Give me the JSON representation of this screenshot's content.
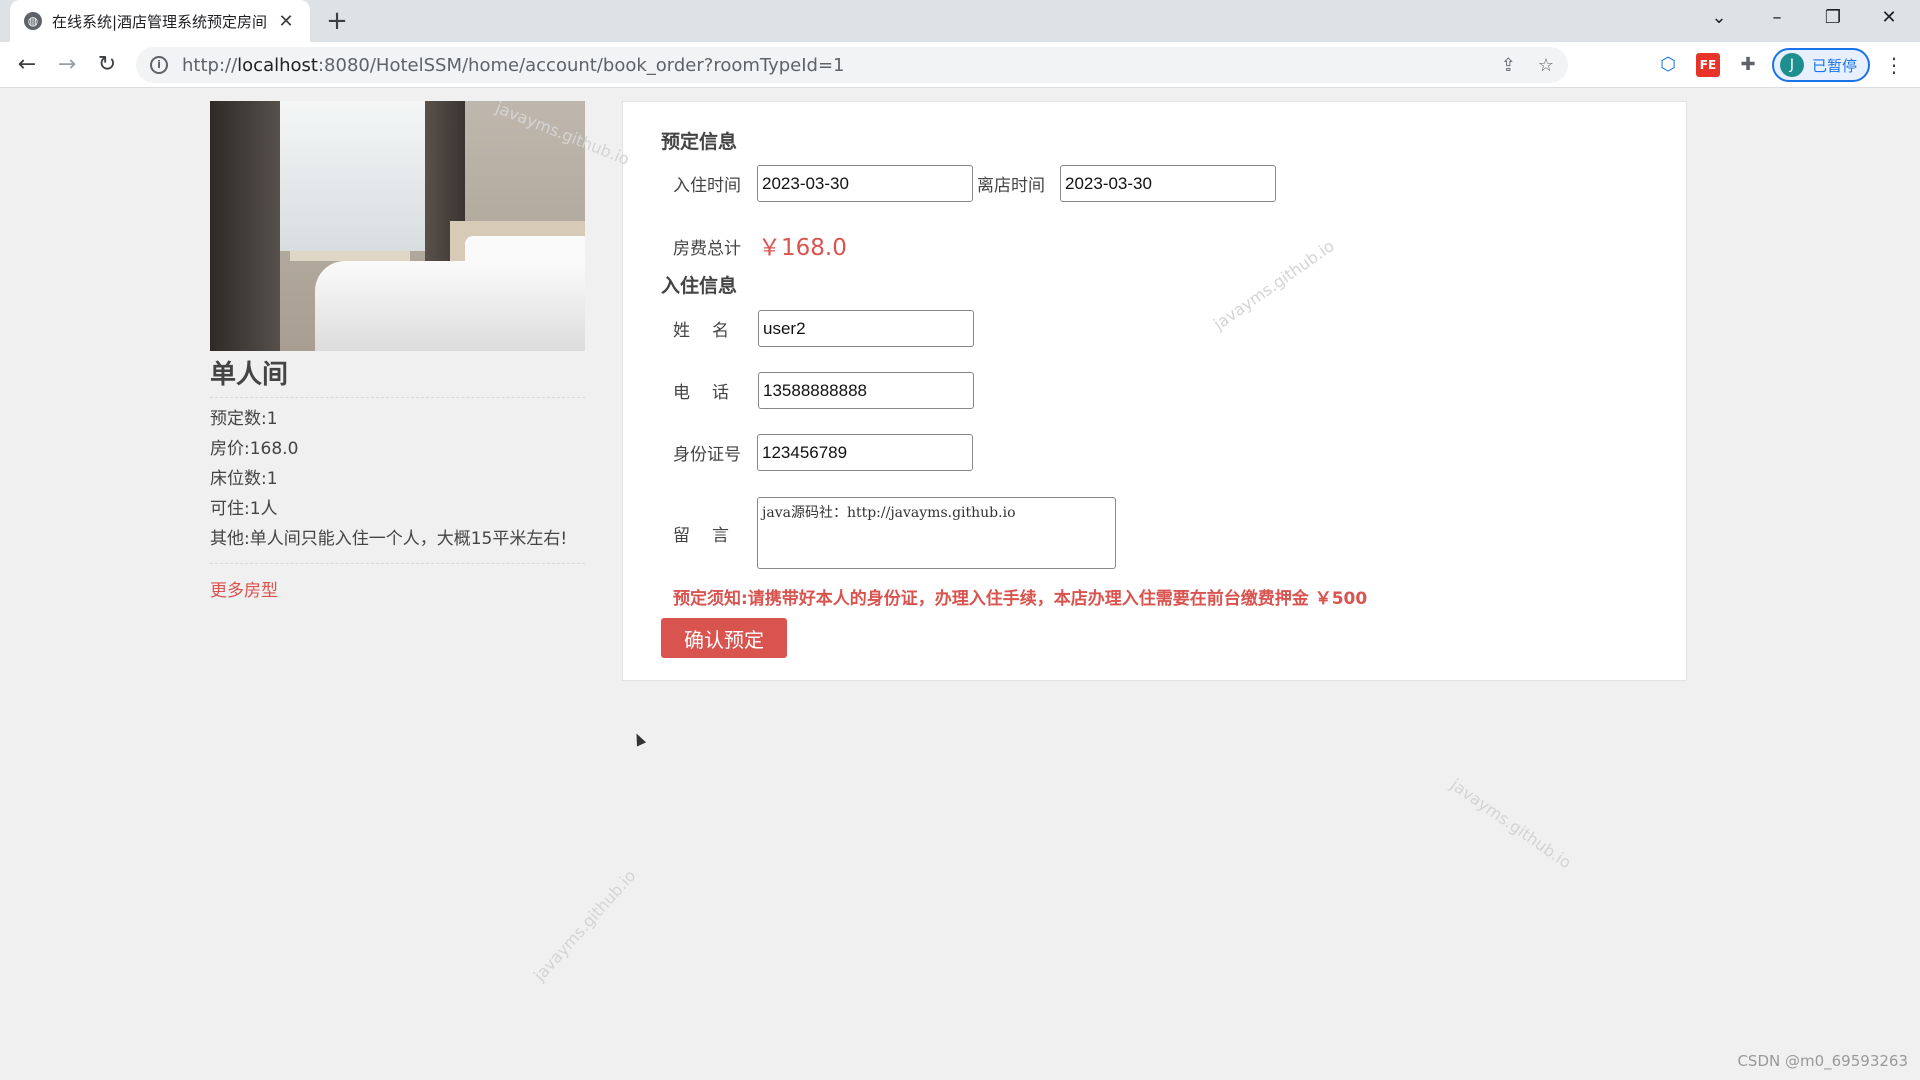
{
  "browser": {
    "tab_title": "在线系统|酒店管理系统预定房间",
    "tab_close": "✕",
    "new_tab": "+",
    "url_scheme": "http://",
    "url_host": "localhost",
    "url_rest": ":8080/HotelSSM/home/account/book_order?roomTypeId=1",
    "profile_initial": "J",
    "profile_status": "已暂停",
    "icons": [
      "back-icon",
      "forward-icon",
      "reload-icon",
      "info-icon",
      "share-icon",
      "star-icon",
      "extension-icon",
      "fe-icon",
      "puzzle-icon",
      "menu-icon"
    ]
  },
  "room": {
    "name": "单人间",
    "details": [
      {
        "label": "预定数:",
        "value": "1"
      },
      {
        "label": "房价:",
        "value": "168.0"
      },
      {
        "label": "床位数:",
        "value": "1"
      },
      {
        "label": "可住:",
        "value": "1人"
      },
      {
        "label": "其他:",
        "value": "单人间只能入住一个人，大概15平米左右!"
      }
    ],
    "more_link": "更多房型"
  },
  "booking": {
    "section_title": "预定信息",
    "checkin_label": "入住时间",
    "checkin_value": "2023-03-30",
    "checkout_label": "离店时间",
    "checkout_value": "2023-03-30",
    "total_label": "房费总计",
    "total_value": "￥168.0"
  },
  "guest": {
    "section_title": "入住信息",
    "name_label": "姓名",
    "name_value": "user2",
    "phone_label": "电话",
    "phone_value": "13588888888",
    "id_label": "身份证号",
    "id_value": "123456789",
    "message_label": "留言",
    "message_value": "java源码社：http://javayms.github.io"
  },
  "notice": "预定须知:请携带好本人的身份证，办理入住手续，本店办理入住需要在前台缴费押金 ￥500",
  "confirm_button": "确认预定",
  "watermark": "javayms.github.io",
  "csdn_mark": "CSDN @m0_69593263",
  "colors": {
    "accent": "#d9534f",
    "page_bg": "#f0f0f0",
    "panel_bg": "#ffffff"
  }
}
